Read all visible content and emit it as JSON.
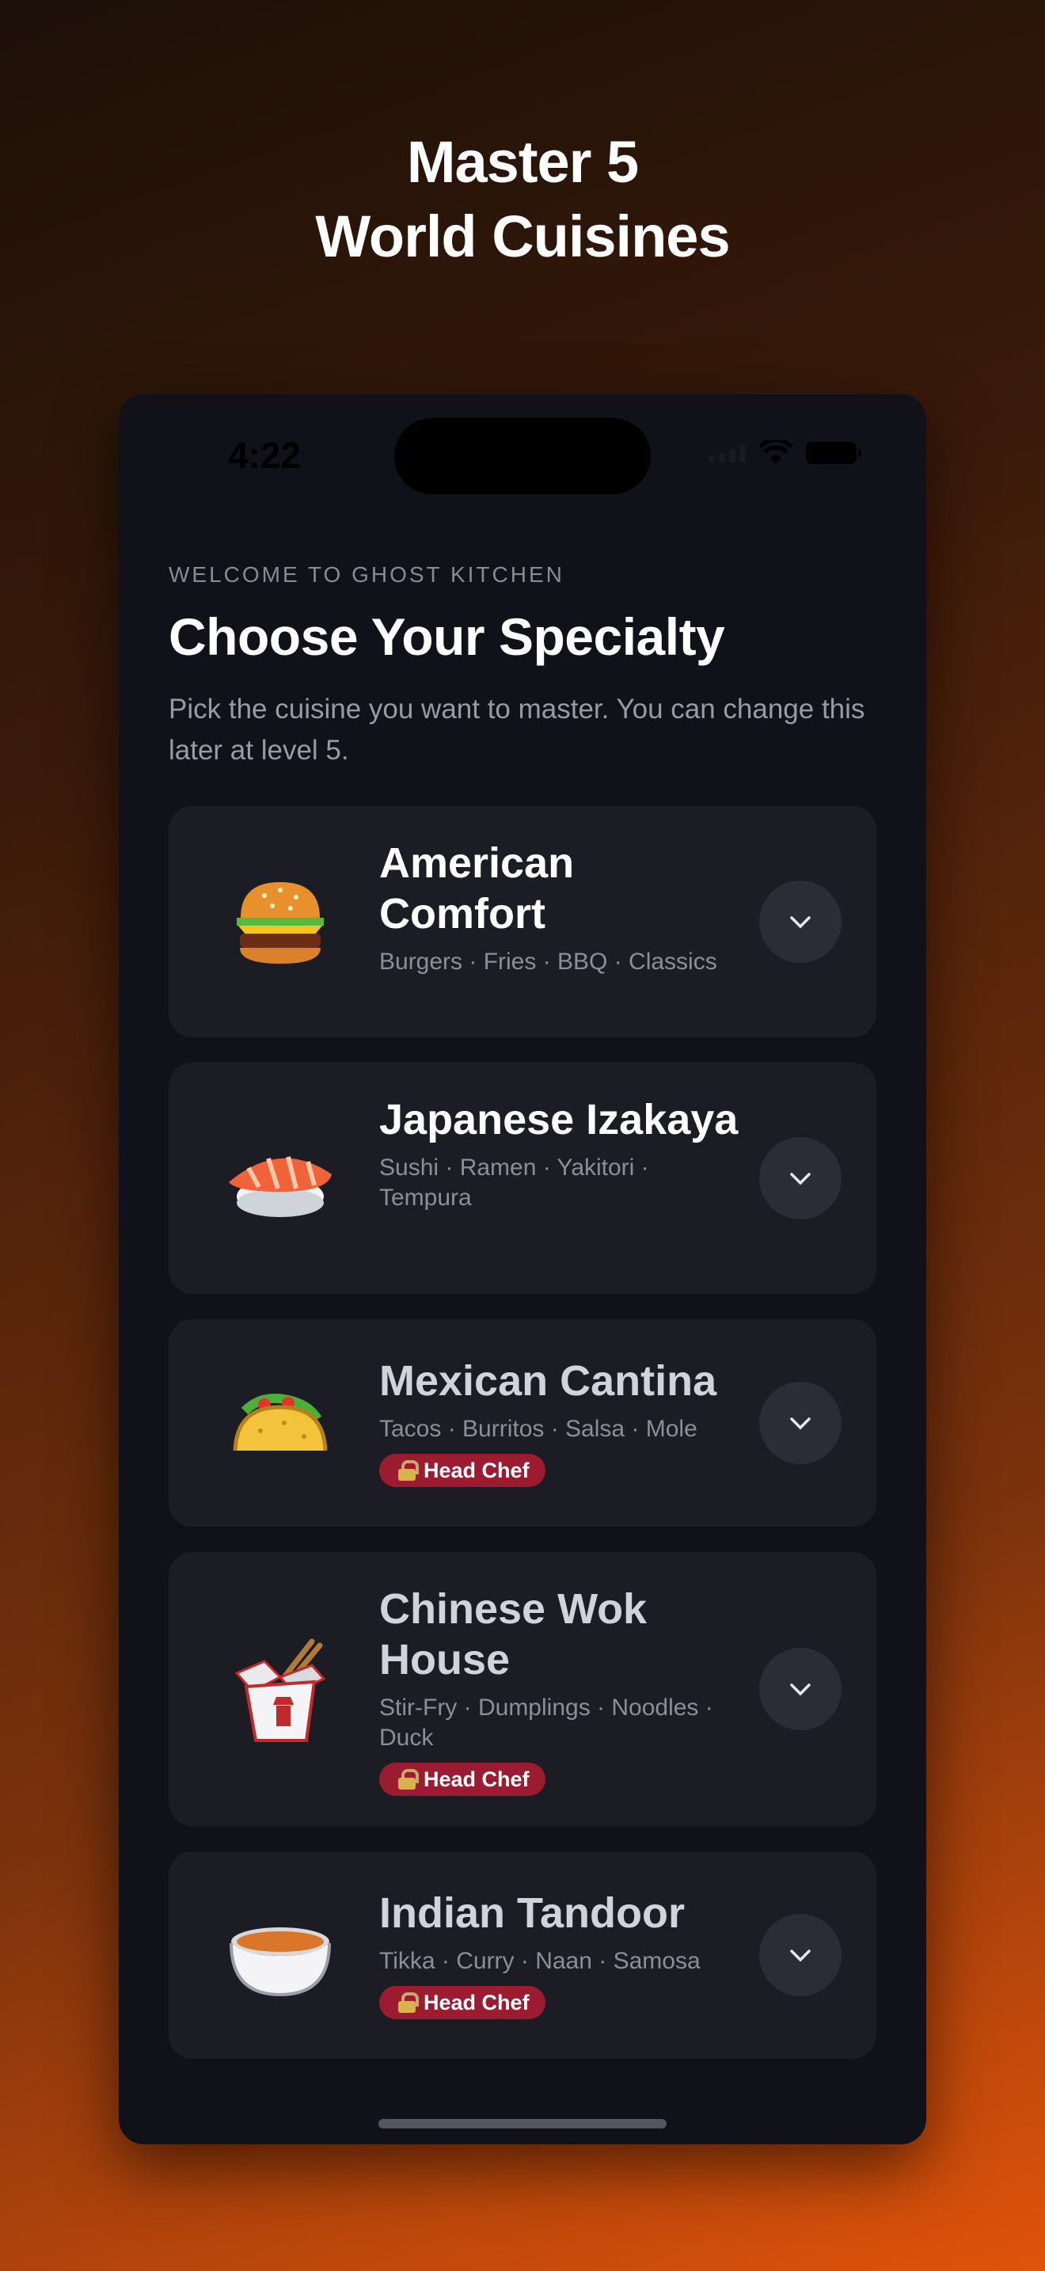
{
  "headline": {
    "line1": "Master 5",
    "line2": "World Cuisines"
  },
  "status_bar": {
    "time": "4:22"
  },
  "screen": {
    "eyebrow": "WELCOME TO GHOST KITCHEN",
    "title": "Choose Your Specialty",
    "subtitle": "Pick the cuisine you want to master. You can change this later at level 5."
  },
  "cuisines": [
    {
      "name": "American Comfort",
      "tags": "Burgers · Fries · BBQ · Classics",
      "icon": "burger-icon",
      "locked": false
    },
    {
      "name": "Japanese Izakaya",
      "tags": "Sushi · Ramen · Yakitori · Tempura",
      "icon": "sushi-icon",
      "locked": false
    },
    {
      "name": "Mexican Cantina",
      "tags": "Tacos · Burritos · Salsa · Mole",
      "icon": "taco-icon",
      "locked": true,
      "badge": "Head Chef"
    },
    {
      "name": "Chinese Wok House",
      "tags": "Stir-Fry · Dumplings · Noodles · Duck",
      "icon": "takeout-box-icon",
      "locked": true,
      "badge": "Head Chef"
    },
    {
      "name": "Indian Tandoor",
      "tags": "Tikka · Curry · Naan · Samosa",
      "icon": "curry-bowl-icon",
      "locked": true,
      "badge": "Head Chef"
    }
  ],
  "colors": {
    "badge": "#9b1b30",
    "card": "#1c1c25",
    "screen": "#111119",
    "accent_orange": "#e0530b"
  }
}
